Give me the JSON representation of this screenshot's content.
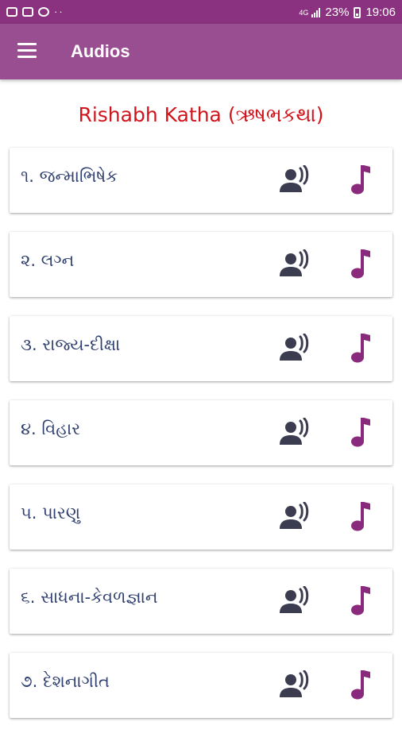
{
  "status_bar": {
    "network": "4G",
    "battery": "23%",
    "time": "19:06"
  },
  "app_bar": {
    "title": "Audios",
    "menu_icon": "hamburger-menu-icon"
  },
  "section": {
    "title": "Rishabh Katha (ઋષભકથા)"
  },
  "colors": {
    "status_bar": "#8a327f",
    "app_bar": "#9a4e92",
    "title_red": "#d0141c",
    "item_text": "#2f3f6f",
    "speaker_icon": "#3c3c50",
    "music_icon": "#8a2a7c"
  },
  "items": [
    {
      "label": "૧. જન્માભિષેક",
      "speak_icon": "person-speaking-icon",
      "music_icon": "music-note-icon"
    },
    {
      "label": "૨. લગ્ન",
      "speak_icon": "person-speaking-icon",
      "music_icon": "music-note-icon"
    },
    {
      "label": "૩. રાજ્ય-દીક્ષા",
      "speak_icon": "person-speaking-icon",
      "music_icon": "music-note-icon"
    },
    {
      "label": "૪. વિહાર",
      "speak_icon": "person-speaking-icon",
      "music_icon": "music-note-icon"
    },
    {
      "label": "૫. પારણુ",
      "speak_icon": "person-speaking-icon",
      "music_icon": "music-note-icon"
    },
    {
      "label": "૬. સાધના-કેવળજ્ઞાન",
      "speak_icon": "person-speaking-icon",
      "music_icon": "music-note-icon"
    },
    {
      "label": "૭. દેશનાગીત",
      "speak_icon": "person-speaking-icon",
      "music_icon": "music-note-icon"
    }
  ]
}
